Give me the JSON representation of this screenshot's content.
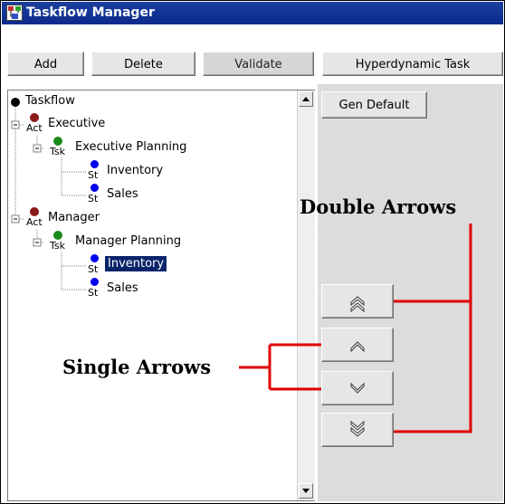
{
  "window": {
    "title": "Taskflow Manager",
    "app_icon": "taskflow-app-icon"
  },
  "toolbar": {
    "add_label": "Add",
    "delete_label": "Delete",
    "validate_label": "Validate",
    "hyperdynamic_label": "Hyperdynamic Task"
  },
  "right_panel": {
    "gen_default_label": "Gen Default"
  },
  "tree": {
    "root": {
      "label": "Taskflow"
    },
    "nodes": [
      {
        "label": "Executive",
        "type_tag": "Act"
      },
      {
        "label": "Executive Planning",
        "type_tag": "Tsk"
      },
      {
        "label": "Inventory",
        "type_tag": "St"
      },
      {
        "label": "Sales",
        "type_tag": "St"
      },
      {
        "label": "Manager",
        "type_tag": "Act"
      },
      {
        "label": "Manager Planning",
        "type_tag": "Tsk"
      },
      {
        "label": "Inventory",
        "type_tag": "St",
        "selected": true
      },
      {
        "label": "Sales",
        "type_tag": "St"
      }
    ],
    "colors": {
      "act": "#8b1a1a",
      "tsk": "#1a8b1a",
      "st": "#0000ee",
      "selection": "#0a246a"
    }
  },
  "annotations": {
    "double_arrows": "Double Arrows",
    "single_arrows": "Single Arrows",
    "callout_color": "#e00000"
  },
  "arrow_buttons": [
    "double-up-arrow-icon",
    "up-arrow-icon",
    "down-arrow-icon",
    "double-down-arrow-icon"
  ]
}
